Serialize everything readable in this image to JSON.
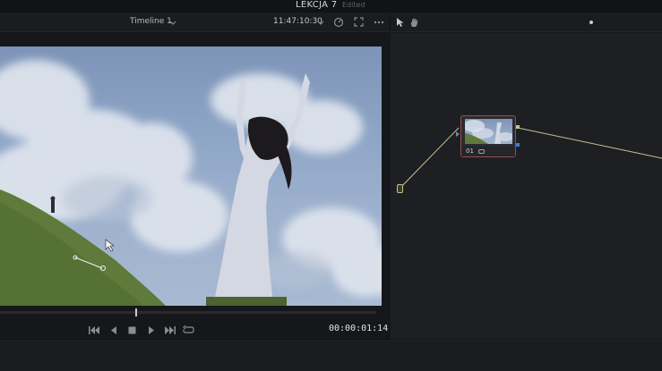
{
  "project": {
    "title": "LEKCJA 7",
    "status": "Edited"
  },
  "viewer": {
    "timeline_name": "Timeline 1",
    "timecode": "11:47:10:30",
    "current_time": "00:00:01:14",
    "playhead_progress": 0.36
  },
  "node_editor": {
    "node_label": "01"
  },
  "colors": {
    "accent_node_border": "#9b4c4c",
    "connector_line": "#c7c28a",
    "panel_bg": "#1e1f23"
  },
  "icons": {
    "timeline_dropdown": "chevron-down-icon",
    "timecode_dropdown": "chevron-down-icon",
    "playback_speed": "speedometer-icon",
    "fullscreen": "fullscreen-icon",
    "more": "more-icon",
    "pointer": "pointer-icon",
    "hand": "hand-icon",
    "go_start": "skip-start-icon",
    "step_back": "step-back-icon",
    "stop": "stop-icon",
    "play": "play-icon",
    "go_end": "skip-end-icon",
    "loop": "loop-icon"
  }
}
